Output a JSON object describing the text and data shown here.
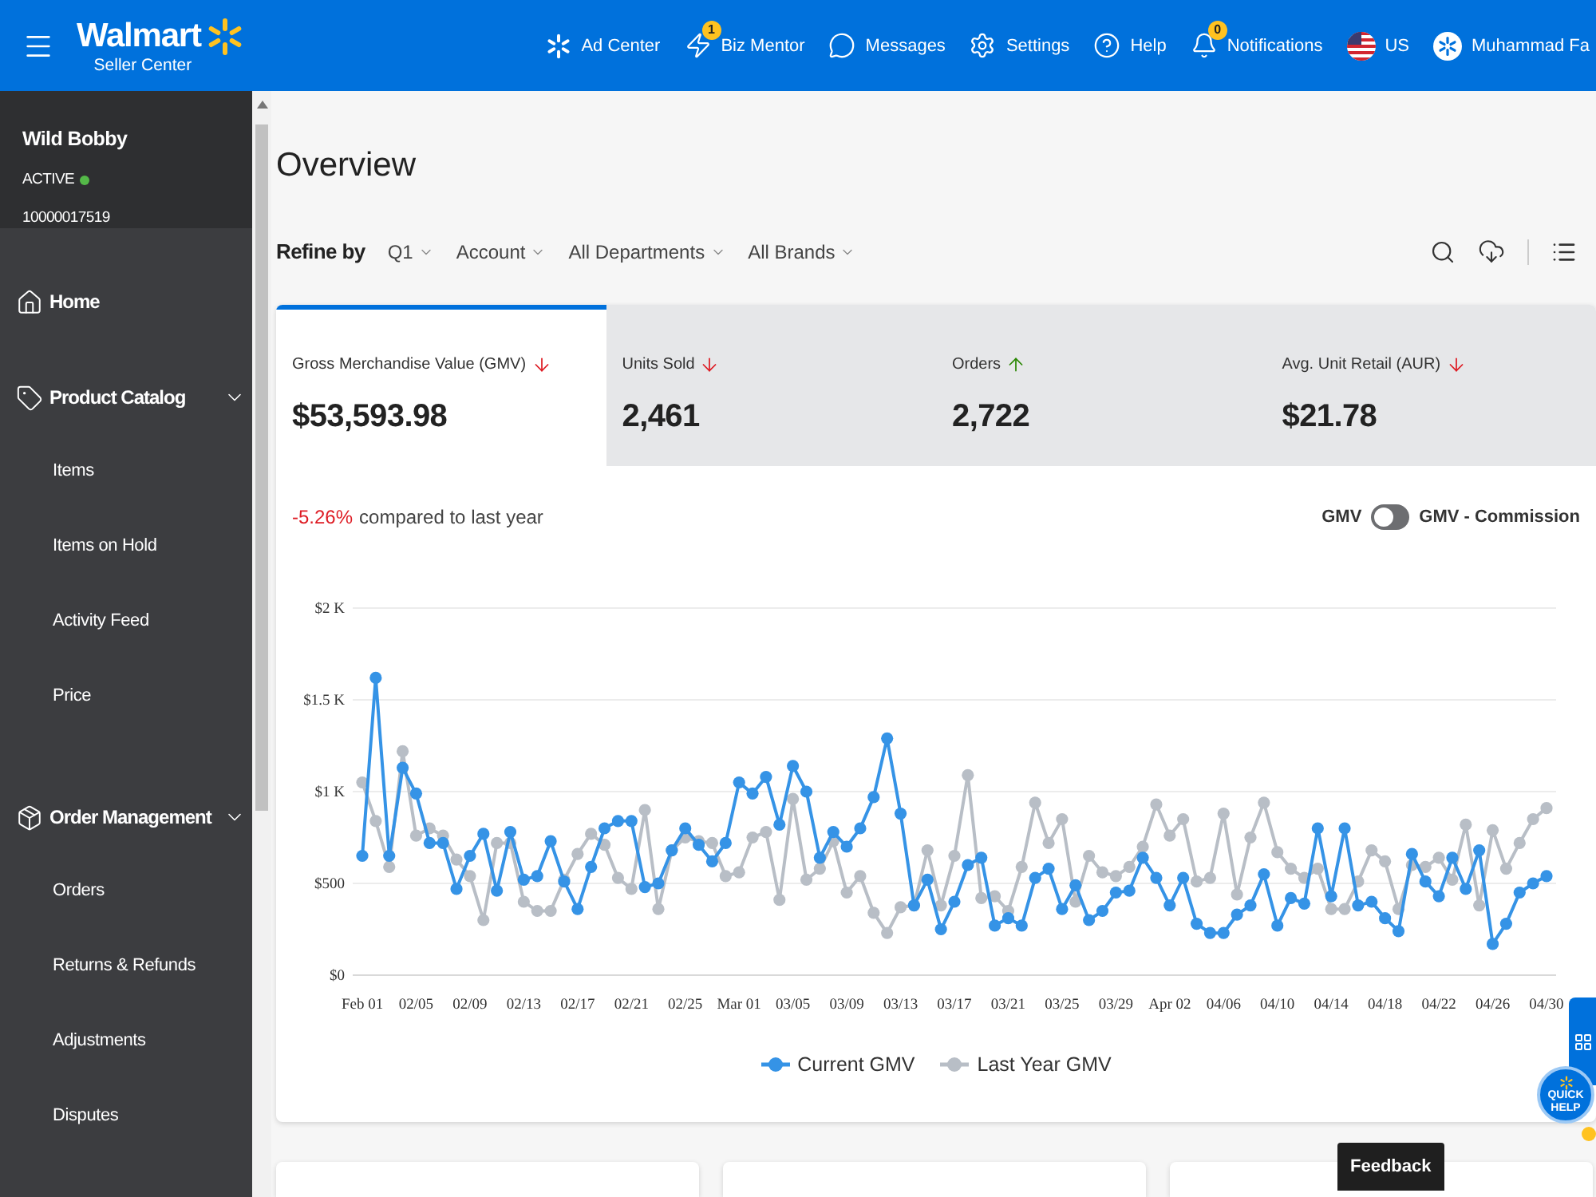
{
  "top_bar": {
    "logo": {
      "name": "Walmart",
      "subtitle": "Seller Center"
    },
    "nav": [
      {
        "label": "Ad Center"
      },
      {
        "label": "Biz Mentor",
        "badge": "1"
      },
      {
        "label": "Messages"
      },
      {
        "label": "Settings"
      },
      {
        "label": "Help"
      },
      {
        "label": "Notifications",
        "badge": "0"
      },
      {
        "label": "US"
      },
      {
        "label": "Muhammad Fa"
      }
    ]
  },
  "sidebar": {
    "account": {
      "name": "Wild Bobby",
      "status": "ACTIVE",
      "id": "10000017519"
    },
    "items": [
      {
        "label": "Home",
        "kind": "link"
      },
      {
        "label": "Product Catalog",
        "kind": "group",
        "expanded": true,
        "children": [
          {
            "label": "Items"
          },
          {
            "label": "Items on Hold"
          },
          {
            "label": "Activity Feed"
          },
          {
            "label": "Price"
          }
        ]
      },
      {
        "label": "Order Management",
        "kind": "group",
        "expanded": true,
        "children": [
          {
            "label": "Orders"
          },
          {
            "label": "Returns & Refunds"
          },
          {
            "label": "Adjustments"
          },
          {
            "label": "Disputes"
          }
        ]
      }
    ]
  },
  "overview": {
    "title": "Overview",
    "refine": {
      "label": "Refine by",
      "filters": [
        "Q1",
        "Account",
        "All Departments",
        "All Brands"
      ]
    },
    "kpis": [
      {
        "label": "Gross Merchandise Value (GMV)",
        "value": "$53,593.98",
        "increase": false,
        "selected": true
      },
      {
        "label": "Units Sold",
        "value": "2,461",
        "increase": false,
        "selected": false
      },
      {
        "label": "Orders",
        "value": "2,722",
        "increase": true,
        "selected": false
      },
      {
        "label": "Avg. Unit Retail (AUR)",
        "value": "$21.78",
        "increase": false,
        "selected": false
      }
    ],
    "comparison": {
      "value": "-5.26%",
      "increase": false,
      "text": "compared to last year"
    },
    "view_toggle": {
      "left_label": "GMV",
      "right_label": "GMV - Commission",
      "on": false
    },
    "chart": {
      "chart_data": {
        "type": "line",
        "grid": true,
        "legend": "bottom",
        "ylim": [
          0,
          2000
        ],
        "categories": [
          "Feb 01",
          null,
          null,
          null,
          "02/05",
          null,
          null,
          null,
          "02/09",
          null,
          null,
          null,
          "02/13",
          null,
          null,
          null,
          "02/17",
          null,
          null,
          null,
          "02/21",
          null,
          null,
          null,
          "02/25",
          null,
          null,
          null,
          "Mar 01",
          null,
          null,
          null,
          "03/05",
          null,
          null,
          null,
          "03/09",
          null,
          null,
          null,
          "03/13",
          null,
          null,
          null,
          "03/17",
          null,
          null,
          null,
          "03/21",
          null,
          null,
          null,
          "03/25",
          null,
          null,
          null,
          "03/29",
          null,
          null,
          null,
          "Apr 02",
          null,
          null,
          null,
          "04/06",
          null,
          null,
          null,
          "04/10",
          null,
          null,
          null,
          "04/14",
          null,
          null,
          null,
          "04/18",
          null,
          null,
          null,
          "04/22",
          null,
          null,
          null,
          "04/26",
          null,
          null,
          null,
          "04/30"
        ],
        "yticks": [
          {
            "value": 0,
            "label": "$0"
          },
          {
            "value": 500,
            "label": "$500"
          },
          {
            "value": 1000,
            "label": "$1 K"
          },
          {
            "value": 1500,
            "label": "$1.5 K"
          },
          {
            "value": 2000,
            "label": "$2 K"
          }
        ],
        "series": [
          {
            "name": "Current GMV",
            "color": "#3593e6",
            "marker": "circle",
            "values": [
              650,
              1620,
              650,
              1130,
              990,
              720,
              720,
              470,
              650,
              770,
              460,
              780,
              520,
              540,
              730,
              510,
              360,
              590,
              800,
              840,
              840,
              480,
              500,
              680,
              800,
              710,
              620,
              720,
              1050,
              990,
              1080,
              820,
              1140,
              1000,
              640,
              780,
              700,
              800,
              970,
              1290,
              880,
              380,
              520,
              250,
              400,
              600,
              640,
              270,
              310,
              270,
              530,
              580,
              360,
              490,
              300,
              350,
              450,
              460,
              640,
              530,
              380,
              530,
              280,
              230,
              230,
              330,
              380,
              550,
              270,
              420,
              390,
              800,
              430,
              800,
              380,
              400,
              310,
              240,
              660,
              510,
              430,
              640,
              470,
              680,
              170,
              280,
              450,
              500,
              540
            ]
          },
          {
            "name": "Last Year GMV",
            "color": "#b8bec6",
            "marker": "circle",
            "values": [
              1050,
              840,
              590,
              1220,
              760,
              800,
              760,
              630,
              540,
              300,
              720,
              720,
              400,
              350,
              350,
              520,
              660,
              770,
              710,
              530,
              470,
              900,
              360,
              680,
              750,
              730,
              720,
              540,
              560,
              750,
              780,
              410,
              960,
              520,
              580,
              730,
              450,
              540,
              340,
              230,
              370,
              380,
              680,
              380,
              650,
              1090,
              420,
              430,
              350,
              590,
              940,
              720,
              850,
              400,
              650,
              560,
              540,
              590,
              700,
              930,
              760,
              850,
              510,
              530,
              880,
              440,
              750,
              940,
              670,
              580,
              530,
              580,
              360,
              360,
              510,
              680,
              620,
              360,
              600,
              590,
              640,
              520,
              820,
              380,
              790,
              580,
              720,
              850,
              910
            ]
          }
        ]
      }
    }
  },
  "feedback": {
    "label": "Feedback"
  },
  "quick_help": {
    "label": "QUICK HELP"
  }
}
